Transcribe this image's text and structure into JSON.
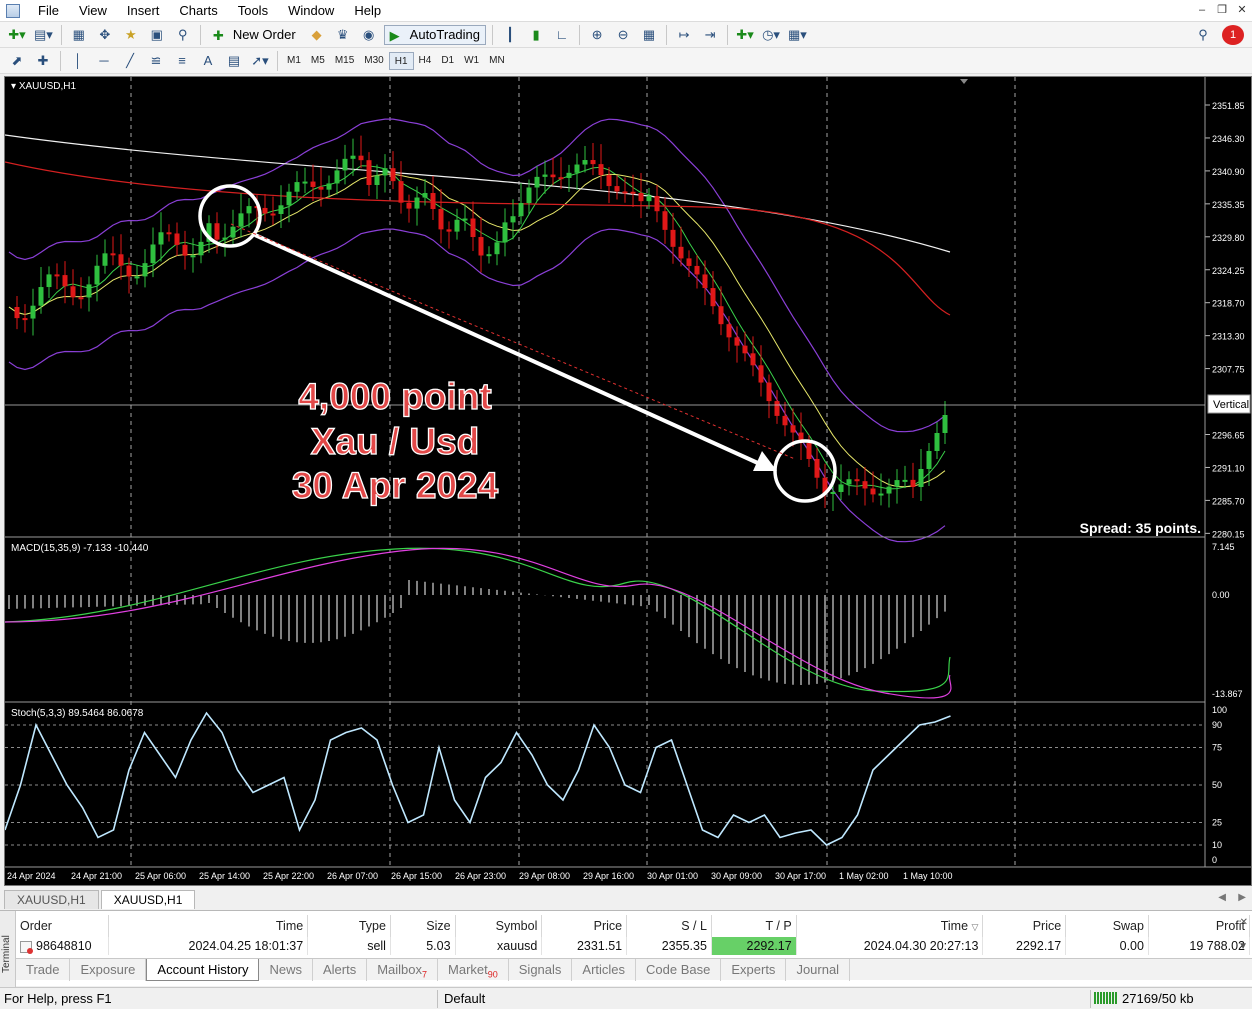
{
  "menu": [
    "File",
    "View",
    "Insert",
    "Charts",
    "Tools",
    "Window",
    "Help"
  ],
  "toolbar": {
    "new_order": "New Order",
    "autotrading": "AutoTrading",
    "timeframes": [
      "M1",
      "M5",
      "M15",
      "M30",
      "H1",
      "H4",
      "D1",
      "W1",
      "MN"
    ],
    "active_timeframe": "H1",
    "notification_count": "1"
  },
  "chart": {
    "symbol_label": "XAUUSD,H1",
    "price_ticks": [
      "2351.85",
      "2346.30",
      "2340.90",
      "2335.35",
      "2329.80",
      "2324.25",
      "2318.70",
      "2313.30",
      "2307.75",
      "2296.65",
      "2291.10",
      "2285.70",
      "2280.15"
    ],
    "vertical_label": "Vertical",
    "spread_text": "Spread: 35 points.",
    "annotation": [
      "4,000 point",
      "Xau / Usd",
      "30 Apr 2024"
    ],
    "macd_label": "MACD(15,35,9) -7.133 -10.440",
    "macd_ticks": [
      "7.145",
      "0.00",
      "-13.867"
    ],
    "stoch_label": "Stoch(5,3,3) 89.5464 86.0678",
    "stoch_ticks": [
      "100",
      "90",
      "75",
      "50",
      "25",
      "10",
      "0"
    ],
    "time_ticks": [
      "24 Apr 2024",
      "24 Apr 21:00",
      "25 Apr 06:00",
      "25 Apr 14:00",
      "25 Apr 22:00",
      "26 Apr 07:00",
      "26 Apr 15:00",
      "26 Apr 23:00",
      "29 Apr 08:00",
      "29 Apr 16:00",
      "30 Apr 01:00",
      "30 Apr 09:00",
      "30 Apr 17:00",
      "1 May 02:00",
      "1 May 10:00"
    ]
  },
  "chart_tabs": [
    "XAUUSD,H1",
    "XAUUSD,H1"
  ],
  "terminal": {
    "side_label": "Terminal",
    "columns": [
      "Order",
      "Time",
      "Type",
      "Size",
      "Symbol",
      "Price",
      "S / L",
      "T / P",
      "Time",
      "Price",
      "Swap",
      "Profit"
    ],
    "row": {
      "order": "98648810",
      "open_time": "2024.04.25 18:01:37",
      "type": "sell",
      "size": "5.03",
      "symbol": "xauusd",
      "price": "2331.51",
      "sl": "2355.35",
      "tp": "2292.17",
      "close_time": "2024.04.30 20:27:13",
      "close_price": "2292.17",
      "swap": "0.00",
      "profit": "19 788.02"
    },
    "tabs": [
      "Trade",
      "Exposure",
      "Account History",
      "News",
      "Alerts",
      "Mailbox",
      "Market",
      "Signals",
      "Articles",
      "Code Base",
      "Experts",
      "Journal"
    ],
    "active_tab": "Account History",
    "mailbox_count": "7",
    "market_count": "90"
  },
  "status": {
    "help": "For Help, press F1",
    "profile": "Default",
    "traffic": "27169/50 kb"
  }
}
